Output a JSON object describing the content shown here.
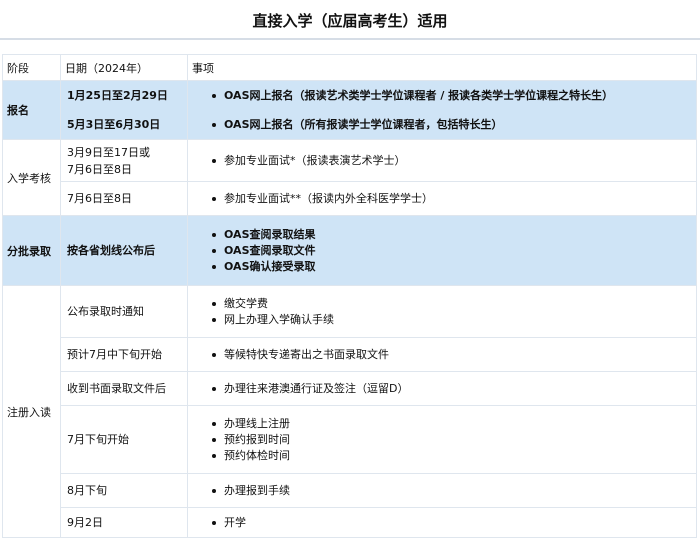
{
  "title": "直接入学（应届高考生）适用",
  "headers": {
    "stage": "阶段",
    "date": "日期（2024年）",
    "item": "事项"
  },
  "rows": {
    "register": {
      "stage": "报名",
      "dates": [
        "1月25日至2月29日",
        "5月3日至6月30日"
      ],
      "items": [
        "OAS网上报名（报读艺术类学士学位课程者 / 报读各类学士学位课程之特长生）",
        "OAS网上报名（所有报读学士学位课程者，包括特长生）"
      ]
    },
    "assess": {
      "stage": "入学考核",
      "sub1": {
        "date": "3月9日至17日或\n7月6日至8日",
        "item": "参加专业面试*（报读表演艺术学士）"
      },
      "sub2": {
        "date": "7月6日至8日",
        "item": "参加专业面试**（报读内外全科医学学士）"
      }
    },
    "admission": {
      "stage": "分批录取",
      "date": "按各省划线公布后",
      "items": [
        "OAS查阅录取结果",
        "OAS查阅录取文件",
        "OAS确认接受录取"
      ]
    },
    "enrol": {
      "stage": "注册入读",
      "subs": [
        {
          "date": "公布录取时通知",
          "items": [
            "缴交学费",
            "网上办理入学确认手续"
          ]
        },
        {
          "date": "预计7月中下旬开始",
          "items": [
            "等候特快专递寄出之书面录取文件"
          ]
        },
        {
          "date": "收到书面录取文件后",
          "items": [
            "办理往来港澳通行证及签注（逗留D）"
          ]
        },
        {
          "date": "7月下旬开始",
          "items": [
            "办理线上注册",
            "预约报到时间",
            "预约体检时间"
          ]
        },
        {
          "date": "8月下旬",
          "items": [
            "办理报到手续"
          ]
        },
        {
          "date": "9月2日",
          "items": [
            "开学"
          ]
        }
      ]
    }
  }
}
